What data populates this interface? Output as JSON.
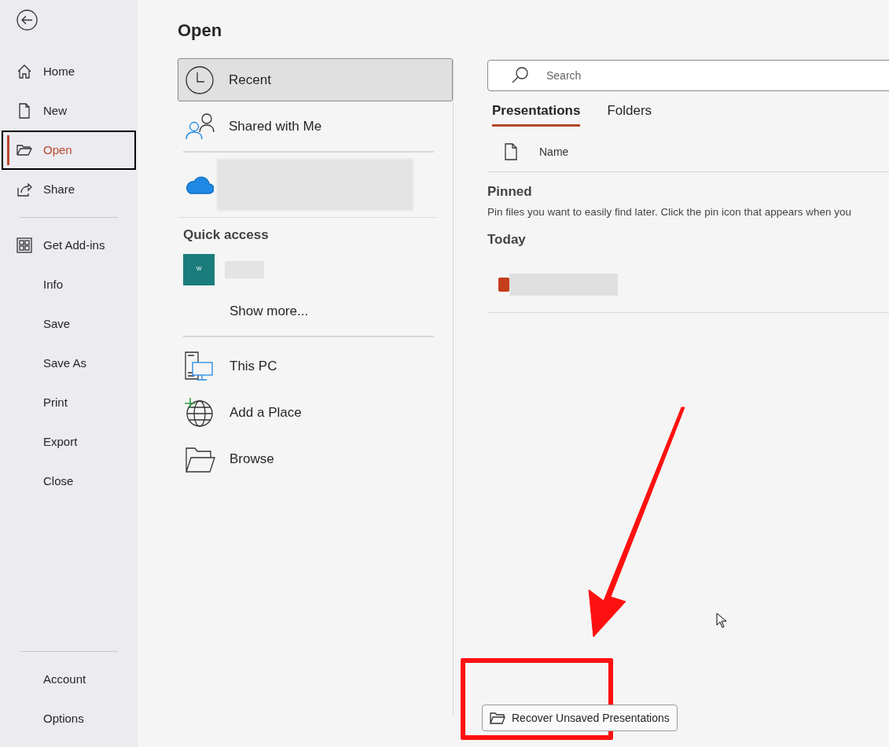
{
  "sidebar": {
    "items": [
      {
        "label": "Home",
        "selected": false
      },
      {
        "label": "New",
        "selected": false
      },
      {
        "label": "Open",
        "selected": true
      },
      {
        "label": "Share",
        "selected": false
      }
    ],
    "more_items": [
      {
        "label": "Get Add-ins",
        "selected": false
      },
      {
        "label": "Info",
        "selected": false
      },
      {
        "label": "Save",
        "selected": false
      },
      {
        "label": "Save As",
        "selected": false
      },
      {
        "label": "Print",
        "selected": false
      },
      {
        "label": "Export",
        "selected": false
      },
      {
        "label": "Close",
        "selected": false
      }
    ],
    "bottom_items": [
      {
        "label": "Account",
        "selected": false
      },
      {
        "label": "Options",
        "selected": false
      }
    ]
  },
  "page_title": "Open",
  "locations": [
    {
      "label": "Recent",
      "selected": true
    },
    {
      "label": "Shared with Me",
      "selected": false
    }
  ],
  "quick_access": {
    "heading": "Quick access",
    "thumbnail_label": "W",
    "show_more": "Show more..."
  },
  "places": [
    {
      "label": "This PC"
    },
    {
      "label": "Add a Place"
    },
    {
      "label": "Browse"
    }
  ],
  "search": {
    "placeholder": "Search"
  },
  "tabs": [
    {
      "label": "Presentations",
      "selected": true
    },
    {
      "label": "Folders",
      "selected": false
    }
  ],
  "list_header": {
    "column": "Name"
  },
  "sections": [
    {
      "heading": "Pinned",
      "text": "Pin files you want to easily find later. Click the pin icon that appears when you"
    },
    {
      "heading": "Today"
    }
  ],
  "recover_button": "Recover Unsaved Presentations"
}
